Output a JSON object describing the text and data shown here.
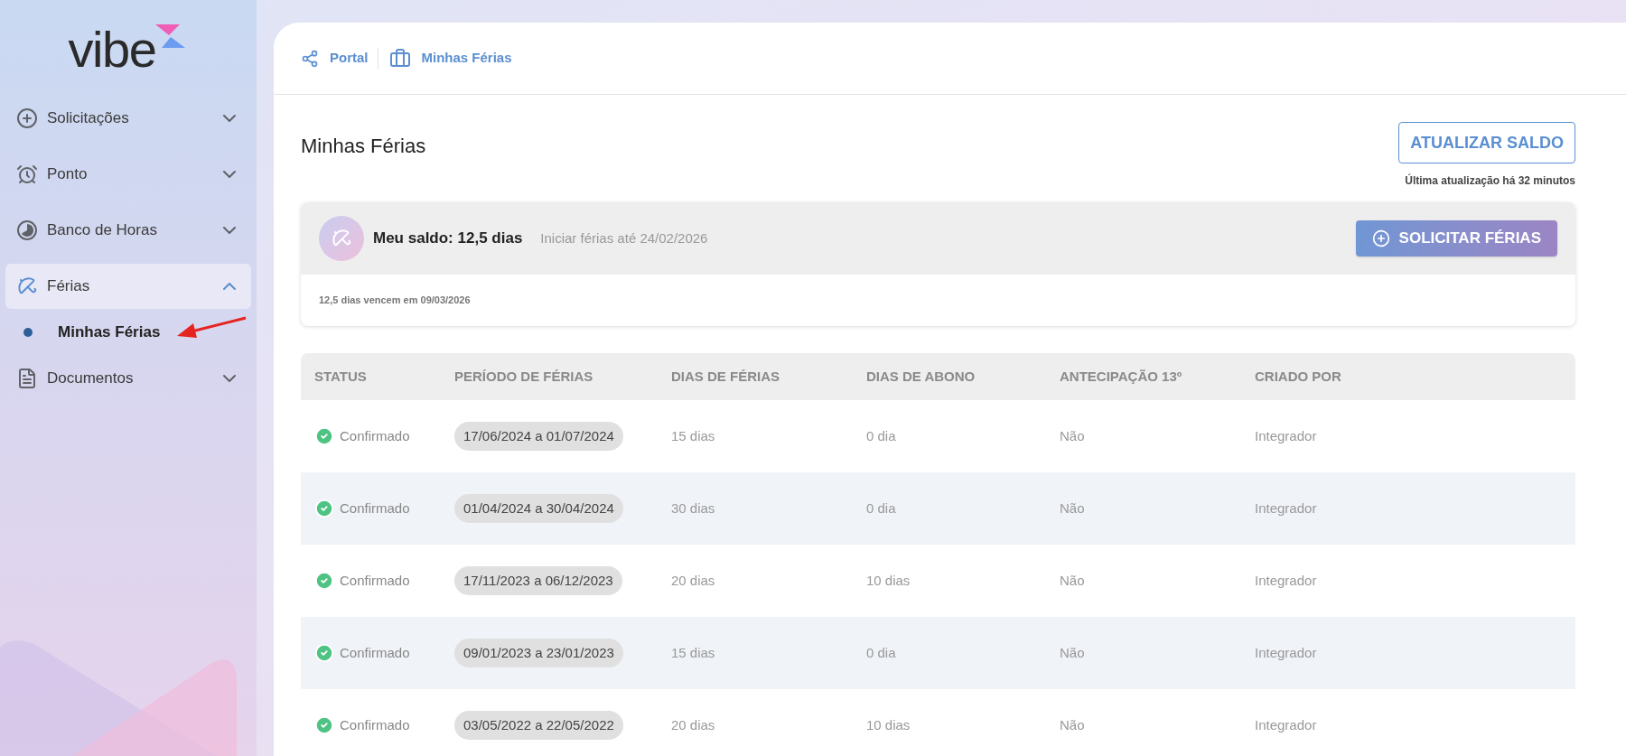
{
  "sidebar": {
    "logo": "vibe",
    "items": [
      {
        "label": "Solicitações",
        "expanded": false,
        "selected": false
      },
      {
        "label": "Ponto",
        "expanded": false,
        "selected": false
      },
      {
        "label": "Banco de Horas",
        "expanded": false,
        "selected": false
      },
      {
        "label": "Férias",
        "expanded": true,
        "selected": true,
        "children": [
          {
            "label": "Minhas Férias",
            "selected": true
          }
        ]
      },
      {
        "label": "Documentos",
        "expanded": false,
        "selected": false
      }
    ]
  },
  "breadcrumb": [
    {
      "label": "Portal"
    },
    {
      "label": "Minhas Férias"
    }
  ],
  "page_title": "Minhas Férias",
  "refresh_button": "ATUALIZAR SALDO",
  "last_update": "Última atualização há 32 minutos",
  "balance": {
    "label": "Meu saldo: 12,5 dias",
    "deadline": "Iniciar férias até 24/02/2026",
    "button": "SOLICITAR FÉRIAS",
    "expiry": "12,5 dias vencem em 09/03/2026"
  },
  "table": {
    "columns": [
      "STATUS",
      "PERÍODO DE FÉRIAS",
      "DIAS DE FÉRIAS",
      "DIAS DE ABONO",
      "ANTECIPAÇÃO 13º",
      "CRIADO POR"
    ],
    "rows": [
      {
        "status": "Confirmado",
        "period": "17/06/2024 a 01/07/2024",
        "days": "15 dias",
        "bonus": "0 dia",
        "advance": "Não",
        "created_by": "Integrador"
      },
      {
        "status": "Confirmado",
        "period": "01/04/2024 a 30/04/2024",
        "days": "30 dias",
        "bonus": "0 dia",
        "advance": "Não",
        "created_by": "Integrador"
      },
      {
        "status": "Confirmado",
        "period": "17/11/2023 a 06/12/2023",
        "days": "20 dias",
        "bonus": "10 dias",
        "advance": "Não",
        "created_by": "Integrador"
      },
      {
        "status": "Confirmado",
        "period": "09/01/2023 a 23/01/2023",
        "days": "15 dias",
        "bonus": "0 dia",
        "advance": "Não",
        "created_by": "Integrador"
      },
      {
        "status": "Confirmado",
        "period": "03/05/2022 a 22/05/2022",
        "days": "20 dias",
        "bonus": "10 dias",
        "advance": "Não",
        "created_by": "Integrador"
      }
    ]
  }
}
